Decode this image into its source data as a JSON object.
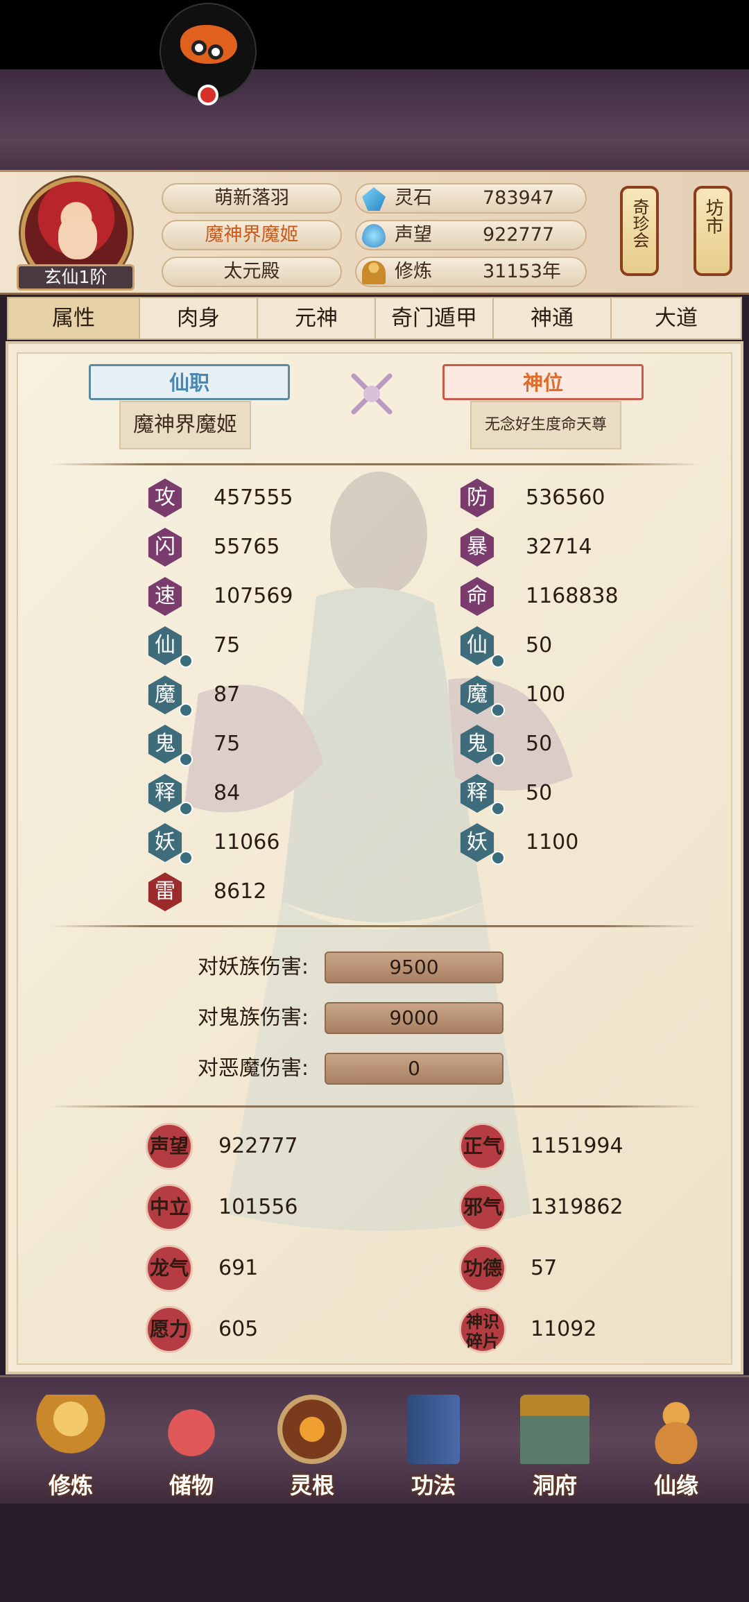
{
  "player": {
    "rank": "玄仙1阶",
    "name": "萌新落羽",
    "title": "魔神界魔姬",
    "sect": "太元殿"
  },
  "resources": [
    {
      "icon": "spirit-stone-icon",
      "label": "灵石",
      "value": "783947"
    },
    {
      "icon": "prestige-icon",
      "label": "声望",
      "value": "922777"
    },
    {
      "icon": "cultivation-icon",
      "label": "修炼",
      "value": "31153年"
    }
  ],
  "lanterns": [
    {
      "label": "奇珍会"
    },
    {
      "label": "坊市"
    }
  ],
  "tabs": [
    "属性",
    "肉身",
    "元神",
    "奇门遁甲",
    "神通",
    "大道"
  ],
  "titles": {
    "immortal_post_label": "仙职",
    "immortal_post_value": "魔神界魔姬",
    "divine_rank_label": "神位",
    "divine_rank_value": "无念好生度命天尊"
  },
  "stats_left": [
    {
      "icon": "攻",
      "value": "457555",
      "color": "purple"
    },
    {
      "icon": "闪",
      "value": "55765",
      "color": "purple"
    },
    {
      "icon": "速",
      "value": "107569",
      "color": "purple"
    },
    {
      "icon": "仙",
      "value": "75",
      "color": "teal"
    },
    {
      "icon": "魔",
      "value": "87",
      "color": "teal"
    },
    {
      "icon": "鬼",
      "value": "75",
      "color": "teal"
    },
    {
      "icon": "释",
      "value": "84",
      "color": "teal"
    },
    {
      "icon": "妖",
      "value": "11066",
      "color": "teal"
    },
    {
      "icon": "雷",
      "value": "8612",
      "color": "red"
    }
  ],
  "stats_right": [
    {
      "icon": "防",
      "value": "536560",
      "color": "purple"
    },
    {
      "icon": "暴",
      "value": "32714",
      "color": "purple"
    },
    {
      "icon": "命",
      "value": "1168838",
      "color": "purple"
    },
    {
      "icon": "仙",
      "value": "50",
      "color": "teal"
    },
    {
      "icon": "魔",
      "value": "100",
      "color": "teal"
    },
    {
      "icon": "鬼",
      "value": "50",
      "color": "teal"
    },
    {
      "icon": "释",
      "value": "50",
      "color": "teal"
    },
    {
      "icon": "妖",
      "value": "1100",
      "color": "teal"
    }
  ],
  "damage": [
    {
      "label": "对妖族伤害:",
      "value": "9500"
    },
    {
      "label": "对鬼族伤害:",
      "value": "9000"
    },
    {
      "label": "对恶魔伤害:",
      "value": "0"
    }
  ],
  "misc_left": [
    {
      "label": "声望",
      "value": "922777"
    },
    {
      "label": "中立",
      "value": "101556"
    },
    {
      "label": "龙气",
      "value": "691"
    },
    {
      "label": "愿力",
      "value": "605"
    }
  ],
  "misc_right": [
    {
      "label": "正气",
      "value": "1151994"
    },
    {
      "label": "邪气",
      "value": "1319862"
    },
    {
      "label": "功德",
      "value": "57"
    },
    {
      "label": "神识碎片",
      "value": "11092"
    }
  ],
  "bottom_nav": [
    {
      "label": "修炼",
      "icon": "meditating-figure-icon",
      "color": "#d8a43a"
    },
    {
      "label": "储物",
      "icon": "treasure-bag-icon",
      "color": "#c24a4a"
    },
    {
      "label": "灵根",
      "icon": "spirit-root-emblem-icon",
      "color": "#7a3a1c"
    },
    {
      "label": "功法",
      "icon": "scripture-book-icon",
      "color": "#4a6aa8"
    },
    {
      "label": "洞府",
      "icon": "cave-dwelling-icon",
      "color": "#5a7a6a"
    },
    {
      "label": "仙缘",
      "icon": "gourd-icon",
      "color": "#d48a3a"
    }
  ]
}
